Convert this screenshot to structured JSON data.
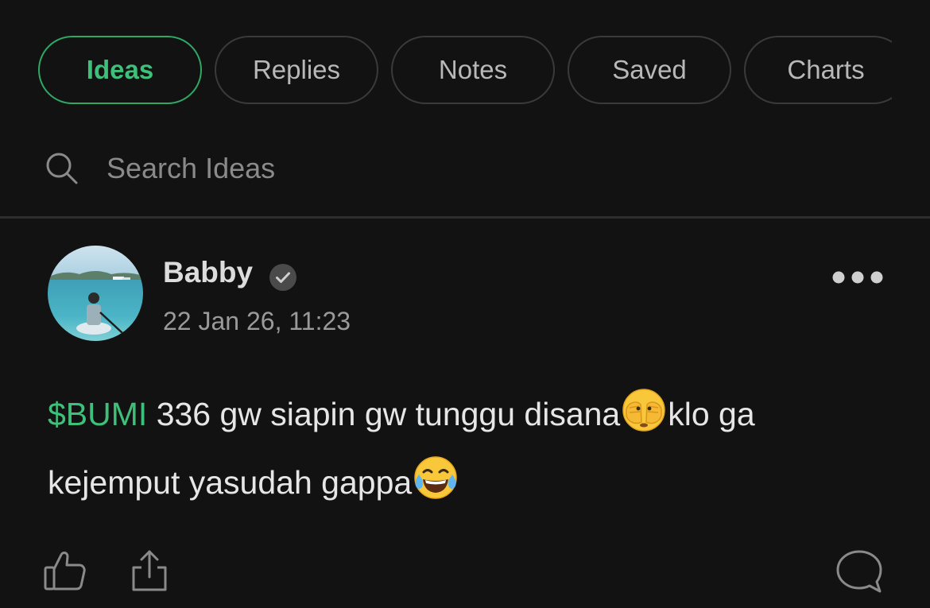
{
  "tabs": [
    {
      "label": "Ideas",
      "active": true
    },
    {
      "label": "Replies",
      "active": false
    },
    {
      "label": "Notes",
      "active": false
    },
    {
      "label": "Saved",
      "active": false
    },
    {
      "label": "Charts",
      "active": false
    }
  ],
  "search": {
    "placeholder": "Search Ideas",
    "icon": "search-icon"
  },
  "post": {
    "author": "Babby",
    "verified_icon": "verified-check-icon",
    "timestamp": "22 Jan 26, 11:23",
    "ticker": "$BUMI",
    "text_part1": " 336 gw siapin gw tunggu disana",
    "emoji1": "🫣",
    "text_part2": "klo ga kejemput yasudah gappa",
    "emoji2": "😂",
    "more_icon": "more-options-icon",
    "actions": [
      "like-icon",
      "share-icon",
      "comment-icon"
    ]
  },
  "colors": {
    "background": "#121212",
    "accent": "#3ec07a",
    "tab_border": "#3a3a3a",
    "divider": "#2e2e2e"
  }
}
